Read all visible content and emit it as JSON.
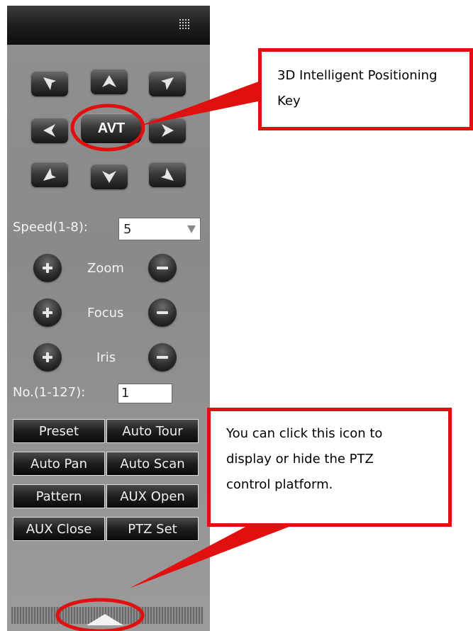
{
  "direction_pad": {
    "buttons": [
      {
        "name": "up-left",
        "icon": "arrow-up-left-icon"
      },
      {
        "name": "up",
        "icon": "arrow-up-icon"
      },
      {
        "name": "up-right",
        "icon": "arrow-up-right-icon"
      },
      {
        "name": "left",
        "icon": "arrow-left-icon"
      },
      {
        "name": "right",
        "icon": "arrow-right-icon"
      },
      {
        "name": "down-left",
        "icon": "arrow-down-left-icon"
      },
      {
        "name": "down",
        "icon": "arrow-down-icon"
      },
      {
        "name": "down-right",
        "icon": "arrow-down-right-icon"
      }
    ],
    "center_label": "AVT"
  },
  "speed": {
    "label": "Speed(1-8):",
    "value": "5"
  },
  "adjust_rows": [
    {
      "label": "Zoom"
    },
    {
      "label": "Focus"
    },
    {
      "label": "Iris"
    }
  ],
  "number": {
    "label": "No.(1-127):",
    "value": "1"
  },
  "function_buttons": [
    "Preset",
    "Auto Tour",
    "Auto Pan",
    "Auto Scan",
    "Pattern",
    "AUX Open",
    "AUX Close",
    "PTZ Set"
  ],
  "callouts": {
    "positioning": [
      "3D Intelligent Positioning",
      "Key"
    ],
    "toggle": [
      "You can click this icon to",
      "display or hide the PTZ",
      "control platform."
    ]
  },
  "colors": {
    "annotation": "#e01010",
    "panel": "#8e8e8e"
  }
}
